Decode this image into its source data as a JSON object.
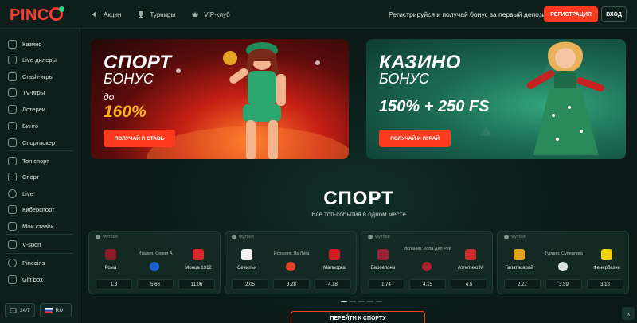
{
  "brand": {
    "logo_text_left": "PINC",
    "logo_o": ""
  },
  "topnav": [
    {
      "label": "Акции",
      "icon": "megaphone-icon"
    },
    {
      "label": "Турниры",
      "icon": "trophy-icon"
    },
    {
      "label": "VIP-клуб",
      "icon": "crown-icon"
    }
  ],
  "header": {
    "promo_text": "Регистрируйся и получай бонус за первый депозит",
    "register_label": "РЕГИСТРАЦИЯ",
    "login_label": "ВХОД"
  },
  "sidebar": {
    "items": [
      {
        "label": "Казино",
        "icon": "casino-icon"
      },
      {
        "label": "Live-дилеры",
        "icon": "dealer-icon"
      },
      {
        "label": "Crash-игры",
        "icon": "crash-icon"
      },
      {
        "label": "TV-игры",
        "icon": "tv-icon"
      },
      {
        "label": "Лотереи",
        "icon": "ticket-icon"
      },
      {
        "label": "Бинго",
        "icon": "bingo-icon"
      },
      {
        "label": "Спортпокер",
        "icon": "poker-icon"
      },
      {
        "label": "Топ спорт",
        "icon": "fire-icon"
      },
      {
        "label": "Спорт",
        "icon": "ball-icon"
      },
      {
        "label": "Live",
        "icon": "live-icon"
      },
      {
        "label": "Киберспорт",
        "icon": "gamepad-icon"
      },
      {
        "label": "Мои ставки",
        "icon": "bets-icon"
      },
      {
        "label": "V-sport",
        "icon": "vsport-icon"
      },
      {
        "label": "Pincoins",
        "icon": "coin-icon"
      },
      {
        "label": "Gift box",
        "icon": "gift-icon"
      }
    ],
    "support_label": "24/7",
    "language_label": "RU"
  },
  "banners": {
    "sport": {
      "title": "СПОРТ",
      "subtitle": "БОНУС",
      "prefix": "до",
      "percent": "160%",
      "button": "ПОЛУЧАЙ И СТАВЬ"
    },
    "casino": {
      "title": "КАЗИНО",
      "subtitle": "БОНУС",
      "offer": "150% + 250 FS",
      "button": "ПОЛУЧАЙ И ИГРАЙ"
    }
  },
  "sport_section": {
    "title": "СПОРТ",
    "subtitle": "Все топ-события в одном месте",
    "button": "ПЕРЕЙТИ К СПОРТУ"
  },
  "matches": [
    {
      "sport": "Футбол",
      "league": "Италия. Серия А",
      "home": "Рома",
      "away": "Монца 1912",
      "odds": [
        "1.3",
        "5.68",
        "11.06"
      ],
      "home_color": "#8a1c2b",
      "away_color": "#d42a2a",
      "league_color": "#1c5fd6"
    },
    {
      "sport": "Футбол",
      "league": "Испания. Ла Лига",
      "home": "Севилья",
      "away": "Мальорка",
      "odds": [
        "2.05",
        "3.28",
        "4.18"
      ],
      "home_color": "#f2f2f2",
      "away_color": "#c9201f",
      "league_color": "#e8402d"
    },
    {
      "sport": "Футбол",
      "league": "Испания. Копа Дел Рей",
      "home": "Барселона",
      "away": "Атлетико М",
      "odds": [
        "1.74",
        "4.15",
        "4.5"
      ],
      "home_color": "#a0203a",
      "away_color": "#cf2b2b",
      "league_color": "#b21e2c"
    },
    {
      "sport": "Футбол",
      "league": "Турция. Суперлига",
      "home": "Галатасарай",
      "away": "Фенербахче",
      "odds": [
        "2.27",
        "3.59",
        "3.18"
      ],
      "home_color": "#e8a21a",
      "away_color": "#f2d20f",
      "league_color": "#d9e3df"
    }
  ]
}
